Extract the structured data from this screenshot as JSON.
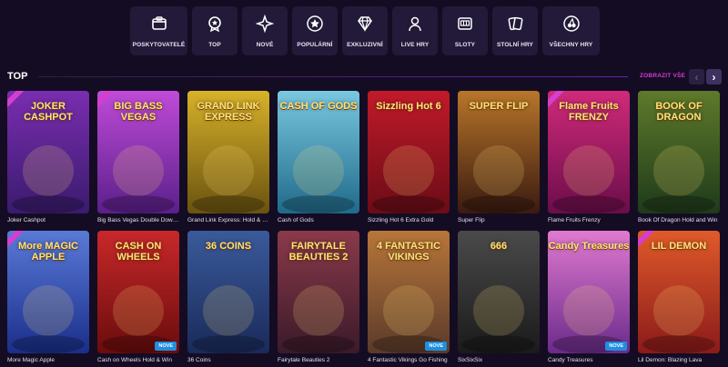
{
  "categories": [
    {
      "label": "POSKYTOVATELÉ",
      "icon": "providers-icon"
    },
    {
      "label": "TOP",
      "icon": "medal-icon"
    },
    {
      "label": "NOVÉ",
      "icon": "new-sparkle-icon"
    },
    {
      "label": "POPULÁRNÍ",
      "icon": "star-icon"
    },
    {
      "label": "EXKLUZIVNÍ",
      "icon": "diamond-icon"
    },
    {
      "label": "LIVE HRY",
      "icon": "live-dealer-icon"
    },
    {
      "label": "SLOTY",
      "icon": "slot-machine-icon"
    },
    {
      "label": "STOLNÍ HRY",
      "icon": "cards-icon"
    },
    {
      "label": "VŠECHNY HRY",
      "icon": "cherries-icon"
    }
  ],
  "section": {
    "title": "TOP",
    "show_all": "ZOBRAZIT VŠE",
    "prev": "‹",
    "next": "›"
  },
  "games": [
    {
      "name": "Joker Cashpot",
      "art": "JOKER CASHPOT",
      "colors": [
        "#3a1b6e",
        "#7a2db0"
      ]
    },
    {
      "name": "Big Bass Vegas Double Down Deluxe",
      "art": "BIG BASS VEGAS",
      "colors": [
        "#5a1f8a",
        "#c04bd8"
      ]
    },
    {
      "name": "Grand Link Express: Hold & Win",
      "art": "GRAND LINK EXPRESS",
      "colors": [
        "#6a5210",
        "#d7b22a"
      ]
    },
    {
      "name": "Cash of Gods",
      "art": "CASH OF GODS",
      "colors": [
        "#1f6a8a",
        "#7ac8e0"
      ]
    },
    {
      "name": "Sizzling Hot 6 Extra Gold",
      "art": "Sizzling Hot 6",
      "colors": [
        "#6a0c16",
        "#c21a2a"
      ]
    },
    {
      "name": "Super Flip",
      "art": "SUPER FLIP",
      "colors": [
        "#3a1a10",
        "#b8762a"
      ]
    },
    {
      "name": "Flame Fruits Frenzy",
      "art": "Flame Fruits FRENZY",
      "colors": [
        "#6a0d4a",
        "#d12a7a"
      ]
    },
    {
      "name": "Book Of Dragon Hold and Win",
      "art": "BOOK OF DRAGON",
      "colors": [
        "#1e3a1a",
        "#5e7a2a"
      ]
    },
    {
      "name": "More Magic Apple",
      "art": "More MAGIC APPLE",
      "colors": [
        "#1a2e8a",
        "#5a7ad8"
      ]
    },
    {
      "name": "Cash on Wheels Hold & Win",
      "art": "CASH ON WHEELS",
      "colors": [
        "#6a0c0c",
        "#c8282a"
      ]
    },
    {
      "name": "36 Coins",
      "art": "36 COINS",
      "colors": [
        "#1a2a5a",
        "#3a5a9a"
      ]
    },
    {
      "name": "Fairytale Beauties 2",
      "art": "FAIRYTALE BEAUTIES 2",
      "colors": [
        "#3a1a2a",
        "#8a3a4a"
      ]
    },
    {
      "name": "4 Fantastic Vikings Go Fishing",
      "art": "4 FANTASTIC VIKINGS",
      "colors": [
        "#5a3a2a",
        "#b8763a"
      ]
    },
    {
      "name": "SixSixSix",
      "art": "666",
      "colors": [
        "#1a1a1a",
        "#4a4a4a"
      ]
    },
    {
      "name": "Candy Treasures",
      "art": "Candy Treasures",
      "colors": [
        "#6a2a8a",
        "#e07ad0"
      ]
    },
    {
      "name": "Lil Demon: Blazing Lava",
      "art": "LIL DEMON",
      "colors": [
        "#8a1a1a",
        "#e05a2a"
      ]
    }
  ],
  "badges": {
    "new": "NOVE"
  }
}
